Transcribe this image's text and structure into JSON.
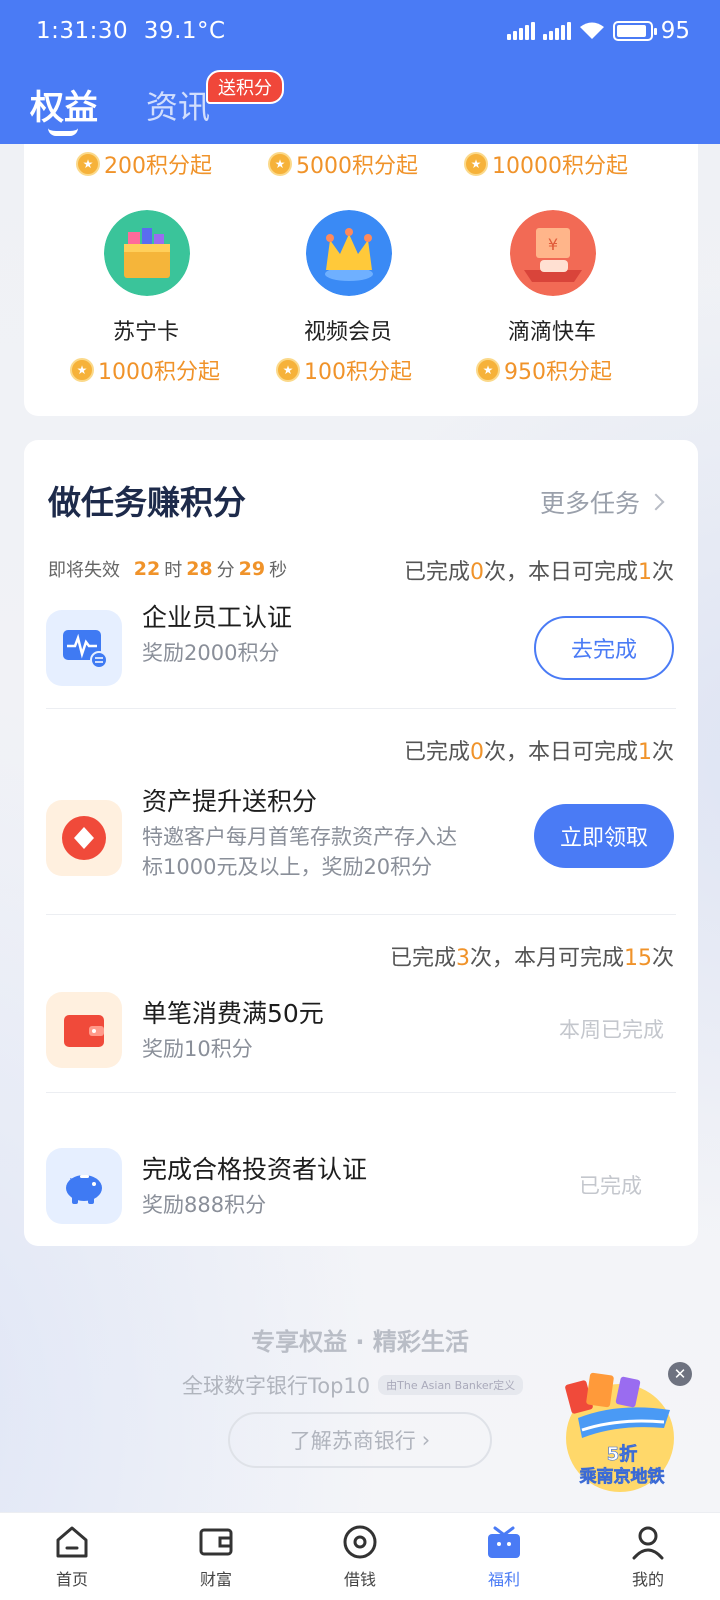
{
  "status_bar": {
    "time": "1:31:30",
    "temperature": "39.1°C",
    "battery": "95"
  },
  "header": {
    "tabs": [
      {
        "label": "权益",
        "active": true
      },
      {
        "label": "资讯",
        "active": false,
        "badge": "送积分"
      }
    ]
  },
  "benefits": {
    "top_row_points": [
      "200积分起",
      "5000积分起",
      "10000积分起"
    ],
    "items": [
      {
        "name": "苏宁卡",
        "points": "1000积分起",
        "icon": "gift-box-icon"
      },
      {
        "name": "视频会员",
        "points": "100积分起",
        "icon": "crown-icon"
      },
      {
        "name": "滴滴快车",
        "points": "950积分起",
        "icon": "ticket-car-icon"
      }
    ]
  },
  "tasks": {
    "title": "做任务赚积分",
    "more": "更多任务",
    "expire": {
      "label": "即将失效",
      "hours": "22",
      "h_unit": "时",
      "minutes": "28",
      "m_unit": "分",
      "seconds": "29",
      "s_unit": "秒"
    },
    "items": [
      {
        "progress": {
          "p1": "已完成",
          "done": "0",
          "p2": "次，本日可完成",
          "total": "1",
          "p3": "次"
        },
        "name": "企业员工认证",
        "desc": "奖励2000积分",
        "action": "去完成",
        "action_type": "outline",
        "icon": "heartbeat-icon"
      },
      {
        "progress": {
          "p1": "已完成",
          "done": "0",
          "p2": "次，本日可完成",
          "total": "1",
          "p3": "次"
        },
        "name": "资产提升送积分",
        "desc_line1": "特邀客户每月首笔存款资产存入达",
        "desc_line2": "标1000元及以上，奖励20积分",
        "action": "立即领取",
        "action_type": "solid",
        "icon": "diamond-icon"
      },
      {
        "progress": {
          "p1": "已完成",
          "done": "3",
          "p2": "次，本月可完成",
          "total": "15",
          "p3": "次"
        },
        "name": "单笔消费满50元",
        "desc": "奖励10积分",
        "action": "本周已完成",
        "action_type": "done",
        "icon": "wallet-icon"
      },
      {
        "name": "完成合格投资者认证",
        "desc": "奖励888积分",
        "action": "已完成",
        "action_type": "done",
        "icon": "piggy-bank-icon"
      }
    ]
  },
  "promo": {
    "title": "专享权益 · 精彩生活",
    "subtitle": "全球数字银行Top10",
    "tag": "由The Asian Banker定义",
    "button": "了解苏商银行"
  },
  "float_ad": {
    "line1": "5折",
    "line2": "乘南京地铁"
  },
  "bottom_nav": [
    {
      "label": "首页",
      "icon": "home-icon"
    },
    {
      "label": "财富",
      "icon": "wallet-icon"
    },
    {
      "label": "借钱",
      "icon": "loan-icon"
    },
    {
      "label": "福利",
      "icon": "gift-icon",
      "active": true
    },
    {
      "label": "我的",
      "icon": "profile-icon"
    }
  ],
  "colors": {
    "brand": "#4a7bf5",
    "accent": "#f0932a",
    "badge": "#f0473a"
  }
}
